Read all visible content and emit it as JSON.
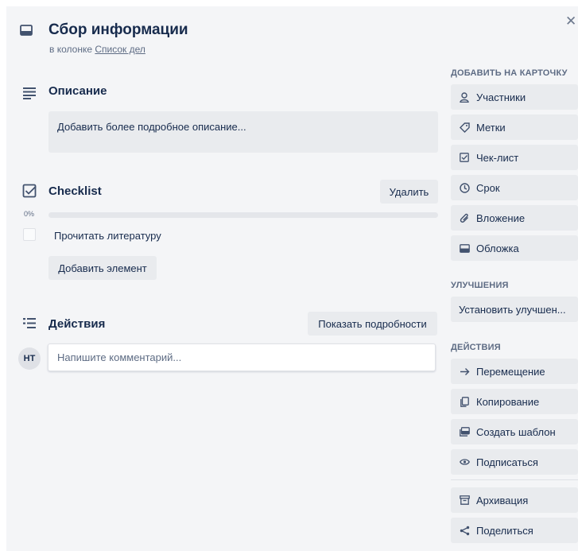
{
  "header": {
    "title": "Сбор информации",
    "subtitle_prefix": "в колонке",
    "list_link": "Список дел"
  },
  "description": {
    "title": "Описание",
    "placeholder": "Добавить более подробное описание..."
  },
  "checklist": {
    "title": "Checklist",
    "delete_label": "Удалить",
    "progress_label": "0%",
    "progress": 0,
    "items": [
      {
        "label": "Прочитать литературу",
        "checked": false
      }
    ],
    "add_item_label": "Добавить элемент"
  },
  "activity": {
    "title": "Действия",
    "show_details_label": "Показать подробности",
    "avatar_initials": "НТ",
    "comment_placeholder": "Напишите комментарий..."
  },
  "sidebar": {
    "add_to_card_heading": "ДОБАВИТЬ НА КАРТОЧКУ",
    "add_to_card": [
      {
        "label": "Участники",
        "icon": "person-icon"
      },
      {
        "label": "Метки",
        "icon": "tag-icon"
      },
      {
        "label": "Чек-лист",
        "icon": "checkbox-icon"
      },
      {
        "label": "Срок",
        "icon": "clock-icon"
      },
      {
        "label": "Вложение",
        "icon": "paperclip-icon"
      },
      {
        "label": "Обложка",
        "icon": "card-cover-icon"
      }
    ],
    "powerups_heading": "УЛУЧШЕНИЯ",
    "powerups_button": "Установить улучшен...",
    "actions_heading": "ДЕЙСТВИЯ",
    "actions": [
      {
        "label": "Перемещение",
        "icon": "arrow-right-icon"
      },
      {
        "label": "Копирование",
        "icon": "copy-icon"
      },
      {
        "label": "Создать шаблон",
        "icon": "template-icon"
      },
      {
        "label": "Подписаться",
        "icon": "eye-icon"
      },
      {
        "label": "Архивация",
        "icon": "archive-icon"
      },
      {
        "label": "Поделиться",
        "icon": "share-icon"
      }
    ]
  },
  "colors": {
    "panel_bg": "#f4f5f7",
    "button_bg": "#e9ebee",
    "text": "#172b4d",
    "muted": "#5e6c84",
    "progress_fill": "#5ba4cf"
  }
}
